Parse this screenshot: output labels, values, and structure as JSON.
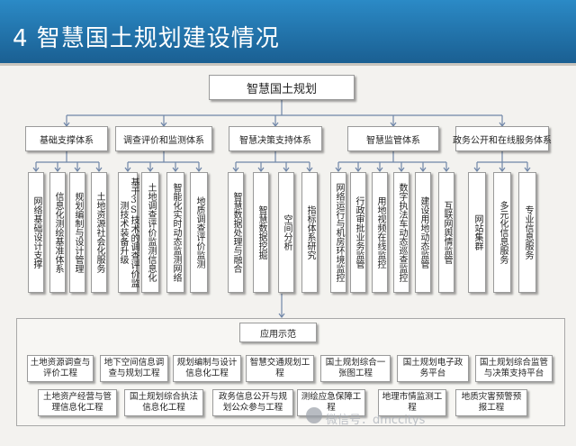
{
  "header": {
    "title": "4  智慧国土规划建设情况"
  },
  "root": "智慧国土规划",
  "categories": [
    {
      "label": "基础支撑体系",
      "items": [
        "网络基础设计支撑",
        "信息化测绘基准体系",
        "规划编制与设计管理",
        "土地资源社会化服务"
      ]
    },
    {
      "label": "调查评价和监测体系",
      "items": [
        "基于3S技术的调查评价监测技术装备升级",
        "土地调查评价监测信息化",
        "智能化实时动态监测网络",
        "地质调查评价监测"
      ]
    },
    {
      "label": "智慧决策支持体系",
      "items": [
        "智慧数据处理与融合",
        "智慧数据挖掘",
        "空间分析",
        "指标体系研究"
      ]
    },
    {
      "label": "智慧监管体系",
      "items": [
        "网络运行与机房环境监控",
        "行政审批业务监管",
        "用地视频在线监控",
        "数字执法车动态巡查监控",
        "建设用地动态监管",
        "互联网舆情监管"
      ]
    },
    {
      "label": "政务公开和在线服务体系",
      "items": [
        "网站集群",
        "多元化信息服务",
        "专业信息服务"
      ]
    }
  ],
  "applications": {
    "label": "应用示范",
    "row1": [
      "土地资源调查与评价工程",
      "地下空间信息调查与规划工程",
      "规划编制与设计信息化工程",
      "智慧交通规划工程",
      "国土规划综合一张图工程",
      "国土规划电子政务平台",
      "国土规划综合监管与决策支持平台"
    ],
    "row2": [
      "土地资产经营与管理信息化工程",
      "国土规划综合执法信息化工程",
      "政务信息公开与规划公众参与工程",
      "测绘应急保障工程",
      "地理市情监测工程",
      "地质灾害预警预报工程"
    ]
  },
  "watermark": "微信号：dmccitys"
}
